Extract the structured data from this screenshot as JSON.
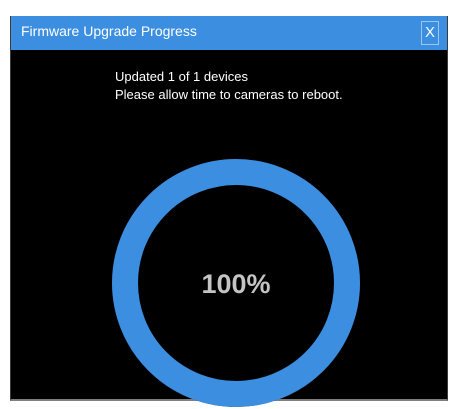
{
  "window": {
    "title": "Firmware Upgrade Progress",
    "close_label": "X"
  },
  "status": {
    "line1": "Updated 1 of 1 devices",
    "line2": "Please allow time to cameras to reboot."
  },
  "progress": {
    "percent_label": "100%",
    "fraction": 1.0,
    "ring_color": "#3c8ee0",
    "track_color": "#1a1a1a"
  },
  "colors": {
    "titlebar": "#3c8ee0",
    "background": "#000000",
    "text": "#ffffff",
    "percent_text": "#c4c4c4"
  }
}
